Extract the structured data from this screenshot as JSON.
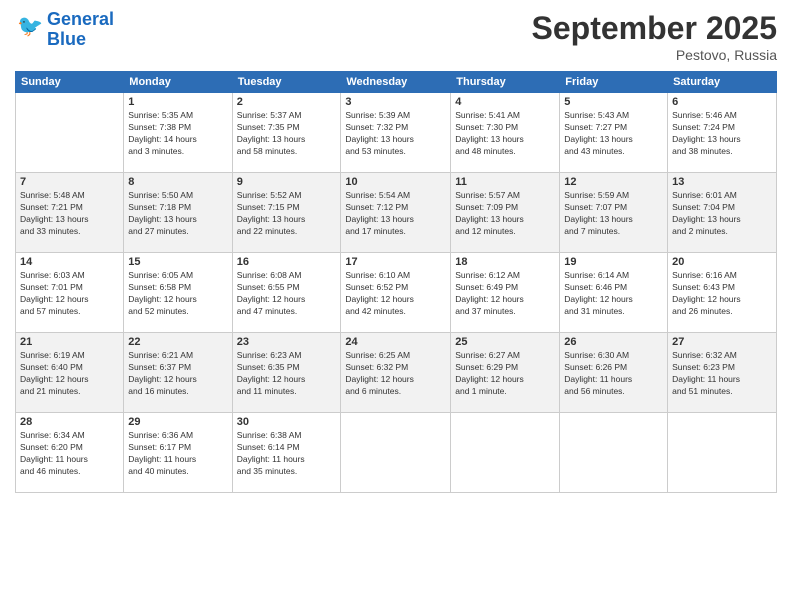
{
  "header": {
    "logo_line1": "General",
    "logo_line2": "Blue",
    "title": "September 2025",
    "location": "Pestovo, Russia"
  },
  "columns": [
    "Sunday",
    "Monday",
    "Tuesday",
    "Wednesday",
    "Thursday",
    "Friday",
    "Saturday"
  ],
  "weeks": [
    [
      {
        "day": "",
        "info": ""
      },
      {
        "day": "1",
        "info": "Sunrise: 5:35 AM\nSunset: 7:38 PM\nDaylight: 14 hours\nand 3 minutes."
      },
      {
        "day": "2",
        "info": "Sunrise: 5:37 AM\nSunset: 7:35 PM\nDaylight: 13 hours\nand 58 minutes."
      },
      {
        "day": "3",
        "info": "Sunrise: 5:39 AM\nSunset: 7:32 PM\nDaylight: 13 hours\nand 53 minutes."
      },
      {
        "day": "4",
        "info": "Sunrise: 5:41 AM\nSunset: 7:30 PM\nDaylight: 13 hours\nand 48 minutes."
      },
      {
        "day": "5",
        "info": "Sunrise: 5:43 AM\nSunset: 7:27 PM\nDaylight: 13 hours\nand 43 minutes."
      },
      {
        "day": "6",
        "info": "Sunrise: 5:46 AM\nSunset: 7:24 PM\nDaylight: 13 hours\nand 38 minutes."
      }
    ],
    [
      {
        "day": "7",
        "info": "Sunrise: 5:48 AM\nSunset: 7:21 PM\nDaylight: 13 hours\nand 33 minutes."
      },
      {
        "day": "8",
        "info": "Sunrise: 5:50 AM\nSunset: 7:18 PM\nDaylight: 13 hours\nand 27 minutes."
      },
      {
        "day": "9",
        "info": "Sunrise: 5:52 AM\nSunset: 7:15 PM\nDaylight: 13 hours\nand 22 minutes."
      },
      {
        "day": "10",
        "info": "Sunrise: 5:54 AM\nSunset: 7:12 PM\nDaylight: 13 hours\nand 17 minutes."
      },
      {
        "day": "11",
        "info": "Sunrise: 5:57 AM\nSunset: 7:09 PM\nDaylight: 13 hours\nand 12 minutes."
      },
      {
        "day": "12",
        "info": "Sunrise: 5:59 AM\nSunset: 7:07 PM\nDaylight: 13 hours\nand 7 minutes."
      },
      {
        "day": "13",
        "info": "Sunrise: 6:01 AM\nSunset: 7:04 PM\nDaylight: 13 hours\nand 2 minutes."
      }
    ],
    [
      {
        "day": "14",
        "info": "Sunrise: 6:03 AM\nSunset: 7:01 PM\nDaylight: 12 hours\nand 57 minutes."
      },
      {
        "day": "15",
        "info": "Sunrise: 6:05 AM\nSunset: 6:58 PM\nDaylight: 12 hours\nand 52 minutes."
      },
      {
        "day": "16",
        "info": "Sunrise: 6:08 AM\nSunset: 6:55 PM\nDaylight: 12 hours\nand 47 minutes."
      },
      {
        "day": "17",
        "info": "Sunrise: 6:10 AM\nSunset: 6:52 PM\nDaylight: 12 hours\nand 42 minutes."
      },
      {
        "day": "18",
        "info": "Sunrise: 6:12 AM\nSunset: 6:49 PM\nDaylight: 12 hours\nand 37 minutes."
      },
      {
        "day": "19",
        "info": "Sunrise: 6:14 AM\nSunset: 6:46 PM\nDaylight: 12 hours\nand 31 minutes."
      },
      {
        "day": "20",
        "info": "Sunrise: 6:16 AM\nSunset: 6:43 PM\nDaylight: 12 hours\nand 26 minutes."
      }
    ],
    [
      {
        "day": "21",
        "info": "Sunrise: 6:19 AM\nSunset: 6:40 PM\nDaylight: 12 hours\nand 21 minutes."
      },
      {
        "day": "22",
        "info": "Sunrise: 6:21 AM\nSunset: 6:37 PM\nDaylight: 12 hours\nand 16 minutes."
      },
      {
        "day": "23",
        "info": "Sunrise: 6:23 AM\nSunset: 6:35 PM\nDaylight: 12 hours\nand 11 minutes."
      },
      {
        "day": "24",
        "info": "Sunrise: 6:25 AM\nSunset: 6:32 PM\nDaylight: 12 hours\nand 6 minutes."
      },
      {
        "day": "25",
        "info": "Sunrise: 6:27 AM\nSunset: 6:29 PM\nDaylight: 12 hours\nand 1 minute."
      },
      {
        "day": "26",
        "info": "Sunrise: 6:30 AM\nSunset: 6:26 PM\nDaylight: 11 hours\nand 56 minutes."
      },
      {
        "day": "27",
        "info": "Sunrise: 6:32 AM\nSunset: 6:23 PM\nDaylight: 11 hours\nand 51 minutes."
      }
    ],
    [
      {
        "day": "28",
        "info": "Sunrise: 6:34 AM\nSunset: 6:20 PM\nDaylight: 11 hours\nand 46 minutes."
      },
      {
        "day": "29",
        "info": "Sunrise: 6:36 AM\nSunset: 6:17 PM\nDaylight: 11 hours\nand 40 minutes."
      },
      {
        "day": "30",
        "info": "Sunrise: 6:38 AM\nSunset: 6:14 PM\nDaylight: 11 hours\nand 35 minutes."
      },
      {
        "day": "",
        "info": ""
      },
      {
        "day": "",
        "info": ""
      },
      {
        "day": "",
        "info": ""
      },
      {
        "day": "",
        "info": ""
      }
    ]
  ]
}
